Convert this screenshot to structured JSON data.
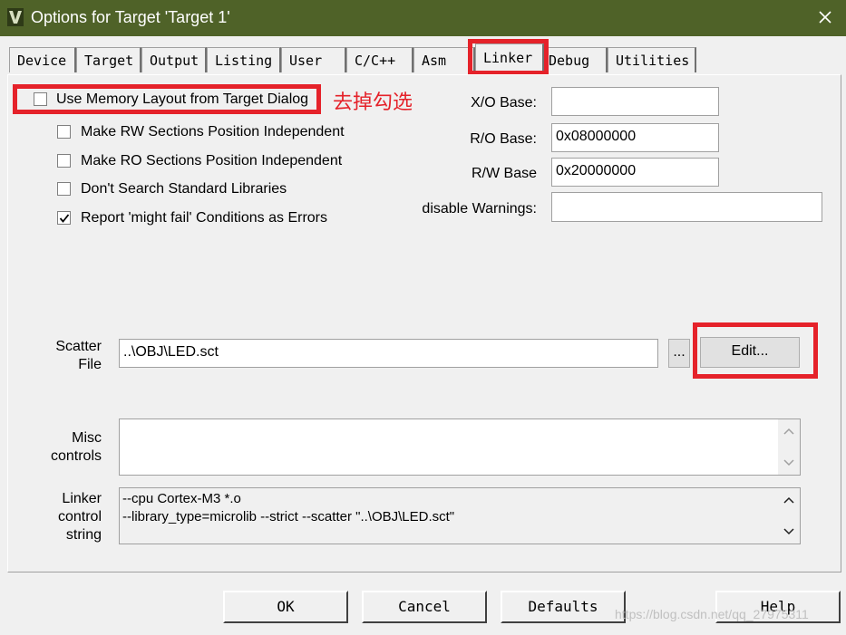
{
  "window": {
    "title": "Options for Target 'Target 1'"
  },
  "tabs": [
    "Device",
    "Target",
    "Output",
    "Listing",
    "User",
    "C/C++",
    "Asm",
    "Linker",
    "Debug",
    "Utilities"
  ],
  "options": {
    "use_memory_layout": {
      "label": "Use Memory Layout from Target Dialog",
      "checked": false
    },
    "rw_independent": {
      "label": "Make RW Sections Position Independent",
      "checked": false
    },
    "ro_independent": {
      "label": "Make RO Sections Position Independent",
      "checked": false
    },
    "dont_search_std": {
      "label": "Don't Search Standard Libraries",
      "checked": false
    },
    "report_might_fail": {
      "label": "Report 'might fail' Conditions as Errors",
      "checked": true
    }
  },
  "annotation": "去掉勾选",
  "fields": {
    "xo_base": {
      "label": "X/O Base:",
      "value": ""
    },
    "ro_base": {
      "label": "R/O Base:",
      "value": "0x08000000"
    },
    "rw_base": {
      "label": "R/W Base",
      "value": "0x20000000"
    },
    "disable_warnings": {
      "label": "disable Warnings:",
      "value": ""
    }
  },
  "scatter": {
    "label_line1": "Scatter",
    "label_line2": "File",
    "value": "..\\OBJ\\LED.sct",
    "browse": "...",
    "edit": "Edit..."
  },
  "misc": {
    "label_line1": "Misc",
    "label_line2": "controls",
    "value": ""
  },
  "linker_string": {
    "label_line1": "Linker",
    "label_line2": "control",
    "label_line3": "string",
    "line1": "--cpu Cortex-M3 *.o",
    "line2": "--library_type=microlib --strict --scatter \"..\\OBJ\\LED.sct\""
  },
  "buttons": {
    "ok": "OK",
    "cancel": "Cancel",
    "defaults": "Defaults",
    "help": "Help"
  },
  "watermark": "https://blog.csdn.net/qq_27975311",
  "colors": {
    "titlebar": "#4f6228",
    "highlight": "#e5222a"
  }
}
